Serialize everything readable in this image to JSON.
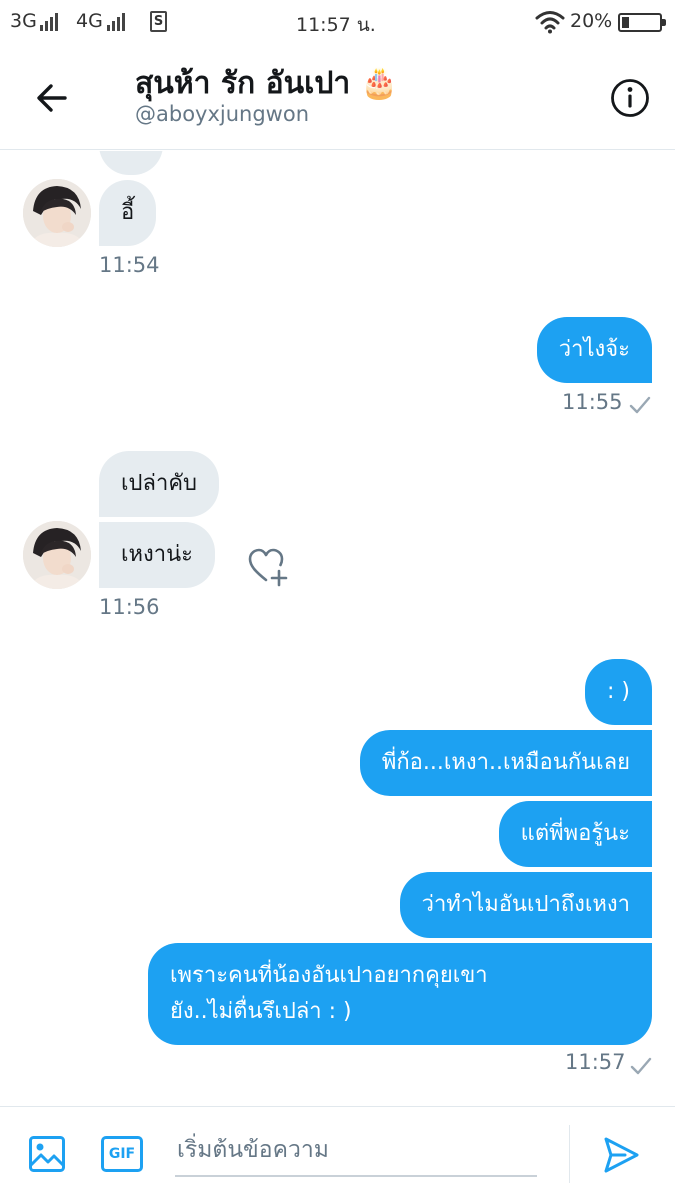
{
  "status_bar": {
    "network1": "3G",
    "network2": "4G",
    "time": "11:57 น.",
    "battery_percent": "20%",
    "battery_level": 0.2
  },
  "header": {
    "title": "สุนห้า รัก อันเปา 🎂",
    "handle": "@aboyxjungwon"
  },
  "messages": [
    {
      "side": "received",
      "text": "อี้",
      "time": "11:54"
    },
    {
      "side": "sent",
      "text": "ว่าไงจ้ะ",
      "time": "11:55"
    },
    {
      "side": "received",
      "text": "เปล่าคับ"
    },
    {
      "side": "received",
      "text": "เหงาน่ะ",
      "time": "11:56"
    },
    {
      "side": "sent",
      "text": ": )"
    },
    {
      "side": "sent",
      "text": "พี่ก้อ...เหงา..เหมือนกันเลย"
    },
    {
      "side": "sent",
      "text": "แต่พี่พอรู้นะ"
    },
    {
      "side": "sent",
      "text": "ว่าทำไมอันเปาถึงเหงา"
    },
    {
      "side": "sent",
      "lines": [
        "เพราะคนที่น้องอันเปาอยากคุยเขา",
        "ยัง..ไม่ตื่นรึเปล่า : )"
      ],
      "time": "11:57"
    }
  ],
  "composer": {
    "gif_label": "GIF",
    "placeholder": "เริ่มต้นข้อความ"
  },
  "colors": {
    "accent": "#1da1f2",
    "received_bubble": "#e6ecf0",
    "meta_text": "#657786"
  }
}
